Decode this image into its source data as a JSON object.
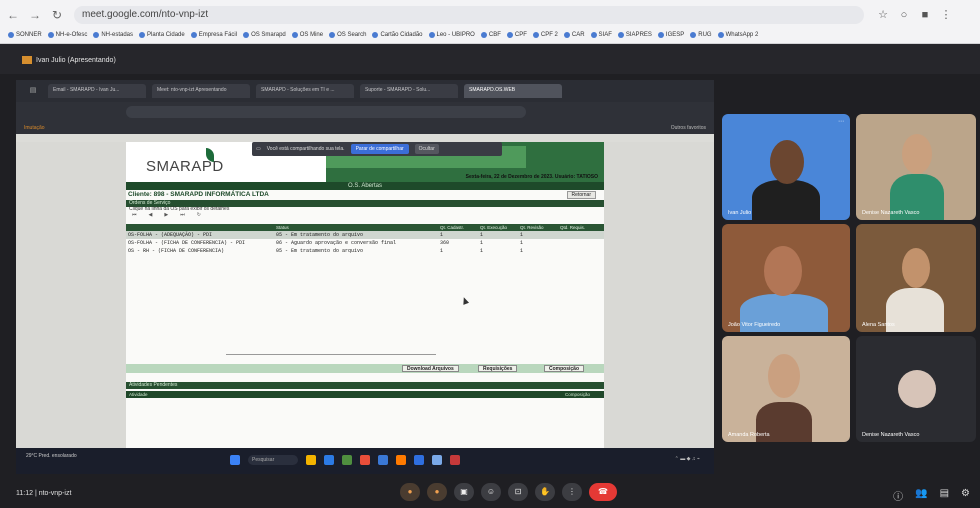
{
  "browser": {
    "url": "meet.google.com/nto-vnp-izt",
    "bookmarks": [
      "SONNER",
      "NH-e-Ofesc",
      "NH-estadas",
      "Planta Cidade",
      "Empresa Fácil",
      "OS Smarapd",
      "OS Mine",
      "OS Search",
      "Cartão Cidadão",
      "Leo - UBIPRO",
      "CBF",
      "CPF",
      "CPF 2",
      "CAR",
      "SIAF",
      "SIAPRES",
      "IGESP",
      "RUG",
      "WhatsApp 2"
    ]
  },
  "meet": {
    "presenter_label": "Ivan Julio (Apresentando)",
    "time_code": "11:12",
    "meeting_code": "nto-vnp-izt"
  },
  "shared_browser": {
    "tabs": [
      "Email - SMARAPD - Ivan Ju...",
      "Meet: nto-vnp-izt Apresentando",
      "SMARAPD - Soluções em TI e ...",
      "Suporte - SMARAPD - Solu...",
      "SMARAPD.OS.WEB"
    ],
    "bookmark_left": "Imutação",
    "bookmark_right": "Outros favoritos",
    "share_banner_text": "Você está compartilhando sua tela.",
    "stop_sharing": "Parar de compartilhar",
    "hide": "Ocultar"
  },
  "app": {
    "logo": "SMARAPD",
    "title": "O.S. Abertas",
    "date_line": "Sexta-feira, 22 de Dezembro de 2023. Usuário: TATIOSO",
    "client": "Cliente: 898 - SMARAPD INFORMÁTICA LTDA",
    "retornar": "Retornar",
    "section_orders": "Ordens de Serviço",
    "hint": "Clique na linha da OS para exibir os detalhes",
    "columns": [
      "",
      "Status",
      "Qt. Cadastr.",
      "Qt. Execução",
      "Qt. Revisão",
      "Qtd. Requis."
    ],
    "rows": [
      [
        "OS-FOLHA - (ADEQUAÇÃO) - PDI",
        "05 - Em tratamento do arquivo",
        "1",
        "1",
        "1",
        ""
      ],
      [
        "OS-FOLHA - (FICHA DE CONFERENCIA) - PDI",
        "06 - Aguardo aprovação e conversão final",
        "360",
        "1",
        "1",
        ""
      ],
      [
        "OS - RH - (FICHA DE CONFERENCIA)",
        "05 - Em tratamento do arquivo",
        "1",
        "1",
        "1",
        ""
      ]
    ],
    "btn_download": "Download Arquivos",
    "btn_requisicoes": "Requisições",
    "btn_composicao": "Composição",
    "section_activities": "Atividades Pendentes",
    "activities_left": "Atividade",
    "activities_right": "Composição"
  },
  "taskbar": {
    "weather": "29°C Pred. ensolarado",
    "search": "Pesquisar"
  },
  "participants": [
    {
      "name": "Ivan Julio"
    },
    {
      "name": "Denise Nazareth Vasco"
    },
    {
      "name": "João Vitor Figueiredo"
    },
    {
      "name": "Alena Santos"
    },
    {
      "name": "Amanda Roberta"
    },
    {
      "name": "Denise Nazareth Vasco"
    }
  ]
}
